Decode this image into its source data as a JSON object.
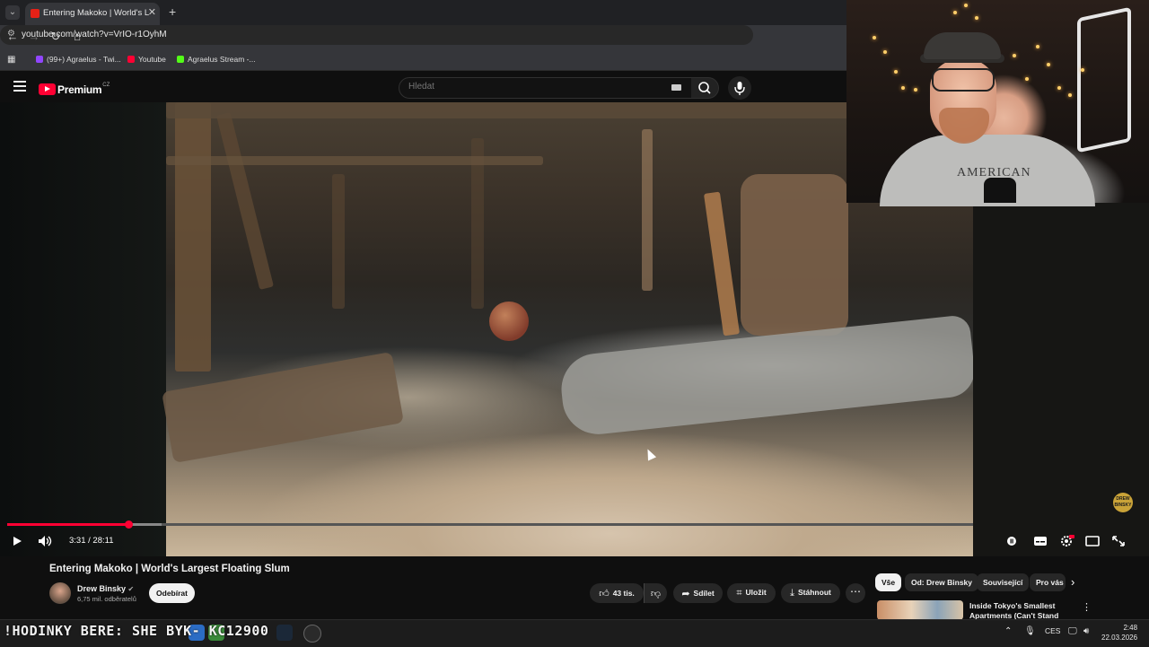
{
  "browser": {
    "tab_title": "Entering Makoko | World's Largest Floating Slum - YouTube",
    "url": "youtube.com/watch?v=VrIO-r1OyhM",
    "bookmarks": [
      {
        "label": "(99+) Agraelus - Twi...",
        "color": "#9146ff"
      },
      {
        "label": "Youtube",
        "color": "#ff0033"
      },
      {
        "label": "Agraelus Stream -...",
        "color": "#53fc18"
      }
    ]
  },
  "header": {
    "logo_text": "Premium",
    "region": "CZ",
    "search_placeholder": "Hledat"
  },
  "player": {
    "time": "3:31 / 28:11",
    "progress": 0.125,
    "buffered": 0.16,
    "badge_text": "DREW BINSKY"
  },
  "video": {
    "title": "Entering Makoko | World's Largest Floating Slum",
    "channel": "Drew Binsky",
    "subscribers": "6,75 mil. odběratelů",
    "subscribe_label": "Odebírat",
    "likes": "43 tis.",
    "share_label": "Sdílet",
    "save_label": "Uložit",
    "download_label": "Stáhnout"
  },
  "sidebar": {
    "chips": [
      "Vše",
      "Od: Drew Binsky",
      "Související",
      "Pro vás"
    ],
    "rec_title": "Inside Tokyo's Smallest Apartments (Can't Stand Up)"
  },
  "webcam": {
    "shirt_text": "AMERICAN"
  },
  "taskbar": {
    "ticker": "!HODINKY BERE: SHE  BYK- KC12900",
    "language": "CES",
    "time": "2:48",
    "date": "22.03.2026"
  },
  "colors": {
    "accent": "#ff0033",
    "background": "#0f0f0f"
  }
}
